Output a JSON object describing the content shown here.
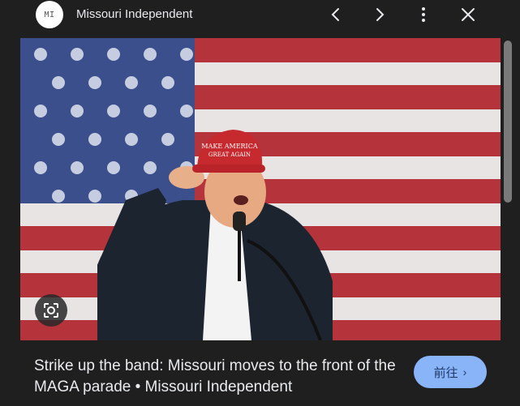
{
  "header": {
    "logo_text": "MI",
    "source_name": "Missouri Independent",
    "prev_icon": "chevron-left-icon",
    "next_icon": "chevron-right-icon",
    "more_icon": "more-vert-icon",
    "close_icon": "close-icon"
  },
  "image": {
    "hat_text_line1": "MAKE AMERICA",
    "hat_text_line2": "GREAT AGAIN",
    "lens_icon": "lens-search-icon"
  },
  "caption": {
    "title": "Strike up the band: Missouri moves to the front of the MAGA parade • Missouri Independent"
  },
  "visit_button": {
    "label": "前往",
    "icon": "chevron-right-icon"
  },
  "colors": {
    "background": "#1f1f1f",
    "accent": "#8ab4f8",
    "text": "#e8eaed"
  }
}
